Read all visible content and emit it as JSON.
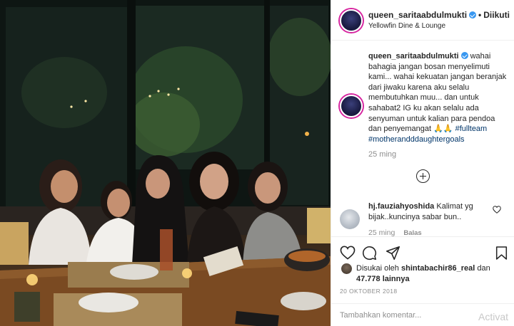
{
  "post": {
    "username": "queen_saritaabdulmukti",
    "follow_label": "Diikuti",
    "location": "Yellowfin Dine & Lounge"
  },
  "caption": {
    "username": "queen_saritaabdulmukti",
    "text": "wahai bahagia jangan bosan menyelimuti kami... wahai kekuatan jangan beranjak dari jiwaku karena aku selalu membutuhkan muu... dan untuk sahabat2 IG ku akan selalu ada senyuman untuk kalian para pendoa dan penyemangat 🙏🙏 ",
    "hashtag_1": "#fullteam",
    "hashtag_2": "#motherandddaughtergoals",
    "time": "25 ming"
  },
  "comments": [
    {
      "username": "hj.fauziahyoshida",
      "text": "Kalimat yg bijak..kuncinya sabar bun..",
      "time": "25 ming",
      "reply_label": "Balas"
    }
  ],
  "likes": {
    "prefix": "Disukai oleh",
    "user": "shintabachir86_real",
    "joiner": "dan",
    "count": "47.778 lainnya"
  },
  "date": "20 OKTOBER 2018",
  "add_comment_placeholder": "Tambahkan komentar...",
  "watermark": "Activat",
  "icons": {
    "like": "heart-icon",
    "comment": "comment-icon",
    "share": "share-icon",
    "save": "bookmark-icon",
    "load_more": "plus-circle-icon",
    "verified": "verified-badge-icon"
  },
  "colors": {
    "text": "#262626",
    "muted": "#8e8e8e",
    "hashtag": "#003569",
    "verified": "#3897f0",
    "border": "#efefef"
  }
}
